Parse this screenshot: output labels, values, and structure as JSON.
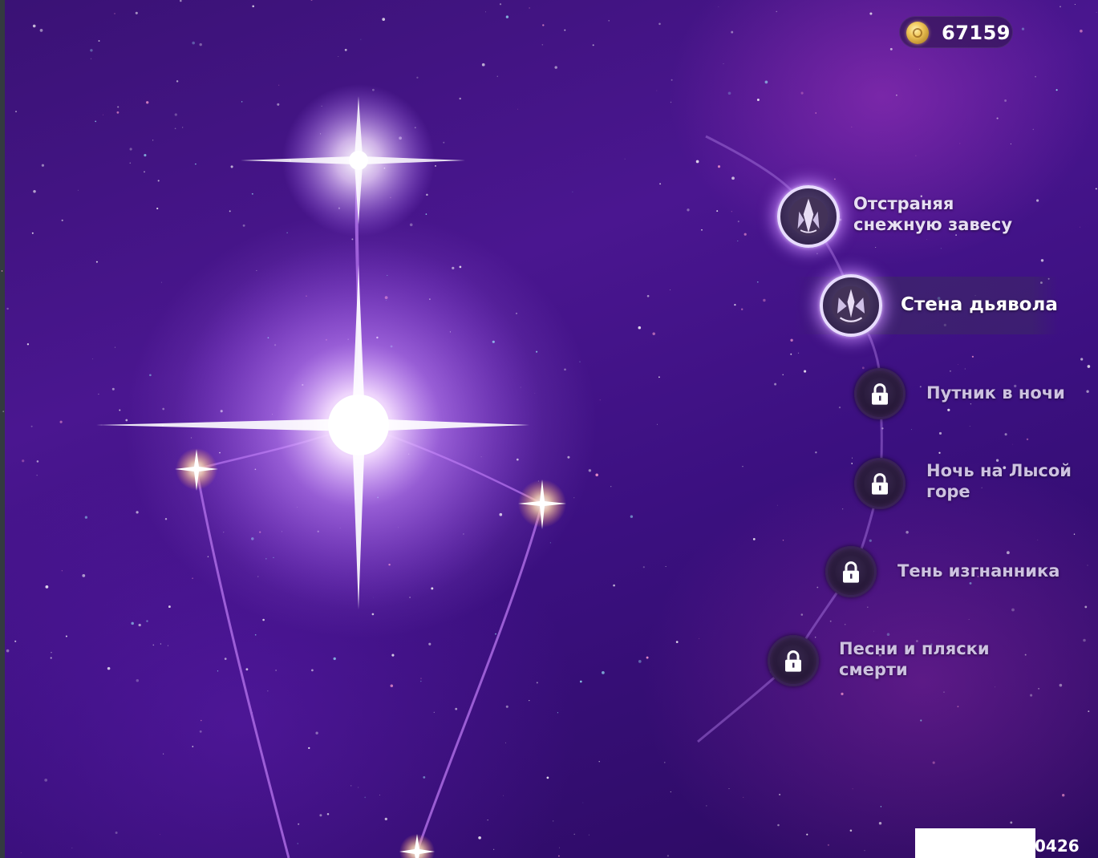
{
  "currency": {
    "value": "67159",
    "icon": "coin-icon"
  },
  "constellation": {
    "nodes": [
      {
        "label_line1": "Отстраняя",
        "label_line2": "снежную завесу",
        "state": "unlocked",
        "icon": "crystal-sigil-icon"
      },
      {
        "label_line1": "Стена дьявола",
        "label_line2": "",
        "state": "unlocked-selected",
        "icon": "crystal-sigil-icon"
      },
      {
        "label_line1": "Путник в ночи",
        "label_line2": "",
        "state": "locked",
        "icon": "lock-icon"
      },
      {
        "label_line1": "Ночь на Лысой",
        "label_line2": "горе",
        "state": "locked",
        "icon": "lock-icon"
      },
      {
        "label_line1": "Тень изгнанника",
        "label_line2": "",
        "state": "locked",
        "icon": "lock-icon"
      },
      {
        "label_line1": "Песни и пляски",
        "label_line2": "смерти",
        "state": "locked",
        "icon": "lock-icon"
      }
    ]
  },
  "uid": {
    "text": "0426"
  },
  "colors": {
    "background": "#3a1275",
    "glow": "#c88cff",
    "label": "#e7dff2"
  }
}
